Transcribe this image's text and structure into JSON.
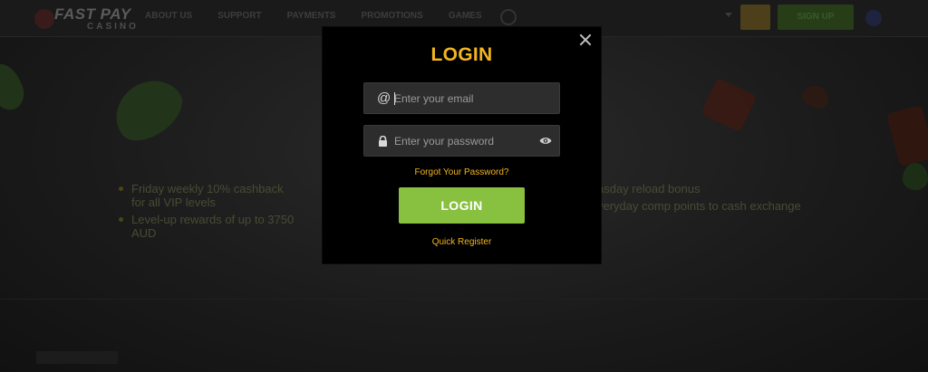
{
  "header": {
    "logo_top": "FAST PAY",
    "logo_bottom": "CASINO",
    "nav": [
      "ABOUT US",
      "SUPPORT",
      "PAYMENTS",
      "PROMOTIONS",
      "GAMES"
    ],
    "signup_label": "SIGN UP"
  },
  "background": {
    "benefits_left": [
      "Friday weekly 10% cashback for all VIP levels",
      "Level-up rewards of up to 3750 AUD"
    ],
    "benefits_right": [
      "asday reload bonus",
      "veryday comp points to cash exchange"
    ]
  },
  "login_modal": {
    "title": "LOGIN",
    "email_placeholder": "Enter your email",
    "email_icon": "@",
    "password_placeholder": "Enter your password",
    "forgot_label": "Forgot Your Password?",
    "submit_label": "LOGIN",
    "register_label": "Quick Register"
  },
  "colors": {
    "accent_gold": "#f2b51f",
    "button_green": "#87c13f",
    "modal_bg": "#000000",
    "field_bg": "#2d2d2d"
  },
  "icons": {
    "close": "close-icon",
    "email": "at-sign-icon",
    "password": "lock-icon",
    "reveal": "eye-icon"
  }
}
